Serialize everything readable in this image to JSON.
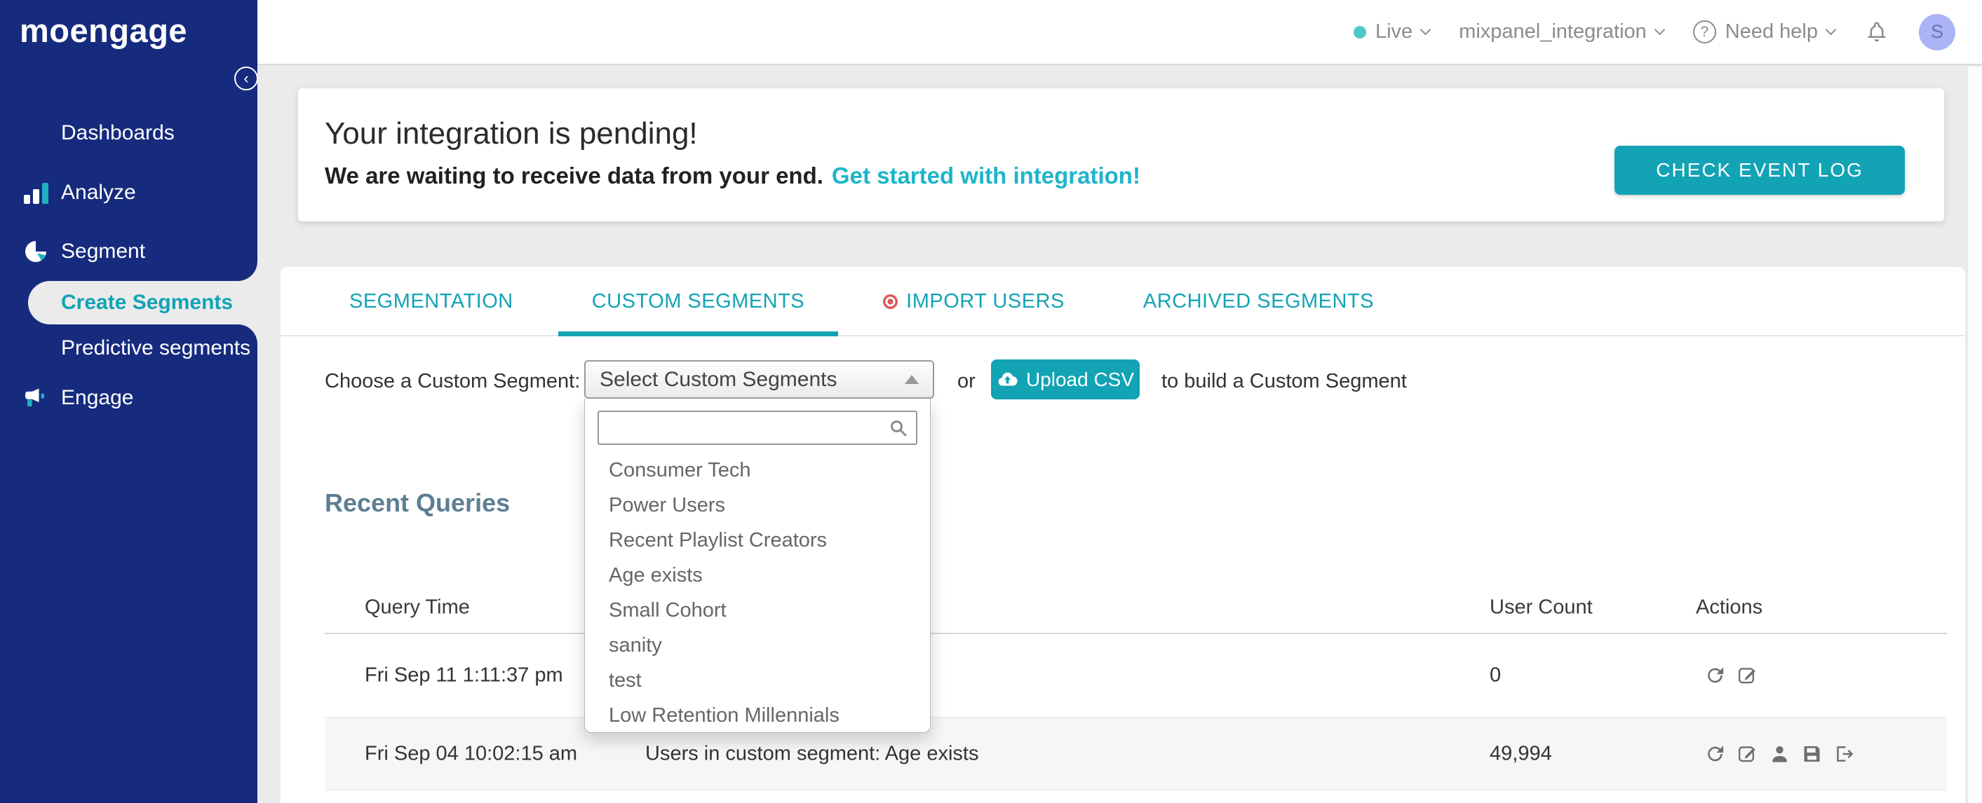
{
  "colors": {
    "sidebar_navy": "#162b7d",
    "accent_teal": "#12a3b5",
    "link_teal": "#1db5c9",
    "live_dot": "#4ecac5",
    "avatar_bg": "#aab4f6",
    "heading_slate": "#5d7e92",
    "import_dot_red": "#dd5a5a",
    "page_bg": "#ebebeb"
  },
  "sidebar": {
    "logo": "moengage",
    "collapse_glyph": "‹",
    "items": [
      {
        "label": "Dashboards",
        "icon": "dashboards-grid-icon"
      },
      {
        "label": "Analyze",
        "icon": "bar-chart-icon"
      },
      {
        "label": "Segment",
        "icon": "pie-chart-icon"
      },
      {
        "label": "Engage",
        "icon": "megaphone-icon"
      }
    ],
    "segment_sub_items": [
      {
        "label": "Create Segments",
        "active": true
      },
      {
        "label": "Predictive segments",
        "active": false
      }
    ]
  },
  "topbar": {
    "env_label": "Live",
    "app_name": "mixpanel_integration",
    "help_label": "Need help",
    "help_glyph": "?",
    "avatar_initial": "S"
  },
  "banner": {
    "title": "Your integration is pending!",
    "subtitle": "We are waiting to receive data from your end.",
    "link_label": "Get started with integration!",
    "button_label": "CHECK EVENT LOG"
  },
  "tabs": [
    {
      "label": "SEGMENTATION",
      "active": false
    },
    {
      "label": "CUSTOM SEGMENTS",
      "active": true
    },
    {
      "label": "IMPORT USERS",
      "active": false,
      "has_red_dot": true
    },
    {
      "label": "ARCHIVED SEGMENTS",
      "active": false
    }
  ],
  "chooser": {
    "label": "Choose a Custom Segment:",
    "select_value": "Select Custom Segments",
    "or_label": "or",
    "upload_button_label": "Upload CSV",
    "suffix_label": "to build a Custom Segment",
    "search_value": "",
    "options": [
      "Consumer Tech",
      "Power Users",
      "Recent Playlist Creators",
      "Age exists",
      "Small Cohort",
      "sanity",
      "test",
      "Low Retention Millennials"
    ]
  },
  "recent_queries": {
    "title": "Recent Queries",
    "columns": {
      "time": "Query Time",
      "count": "User Count",
      "actions": "Actions"
    },
    "rows": [
      {
        "query_time": "Fri Sep 11 1:11:37 pm",
        "description": "",
        "user_count": "0",
        "actions": [
          "refresh",
          "edit"
        ]
      },
      {
        "query_time": "Fri Sep 04 10:02:15 am",
        "description": "Users in custom segment: Age exists",
        "user_count": "49,994",
        "actions": [
          "refresh",
          "edit",
          "user",
          "save",
          "export"
        ]
      }
    ]
  }
}
